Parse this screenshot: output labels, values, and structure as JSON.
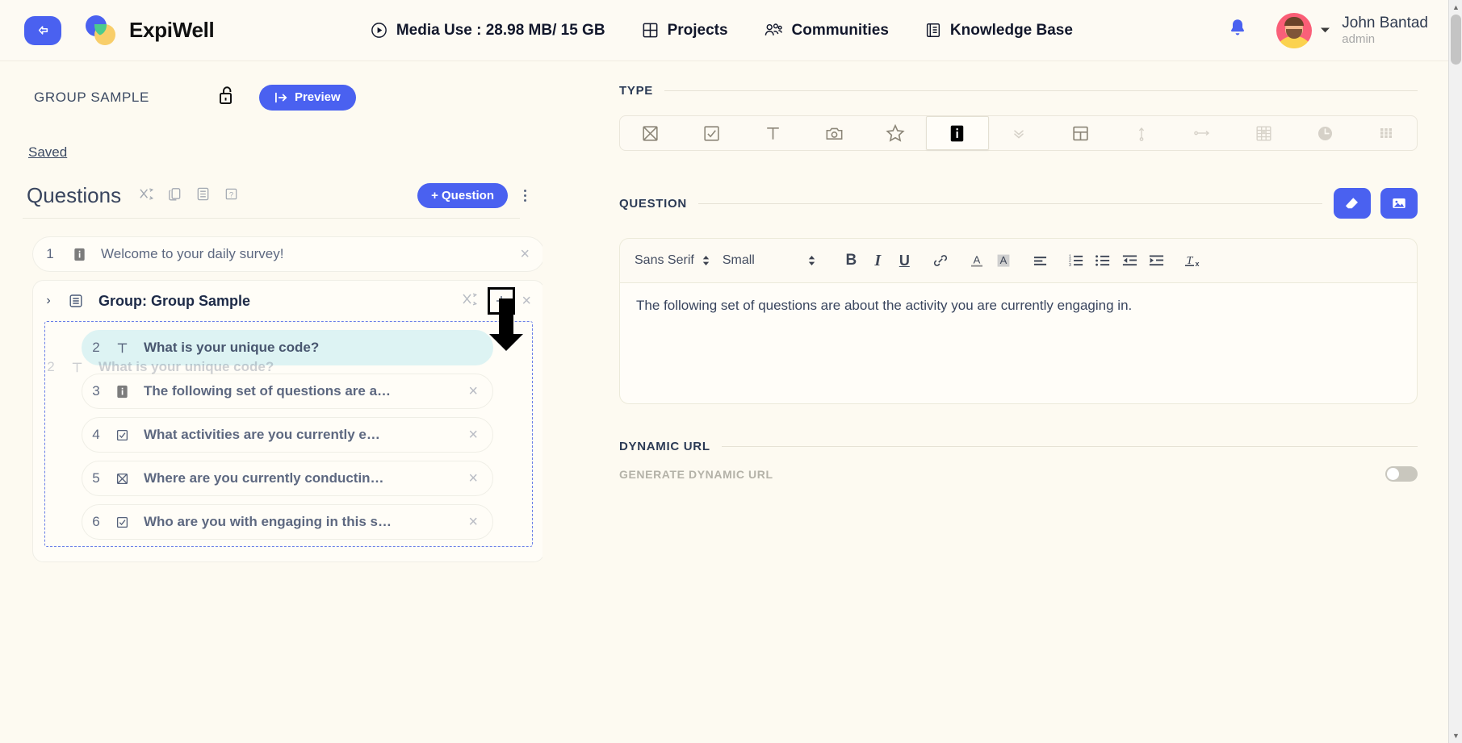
{
  "topbar": {
    "back_icon": "back-arrow-icon",
    "brand": "ExpiWell",
    "media_use": "Media Use : 28.98 MB/ 15 GB",
    "nav": [
      {
        "label": "Projects",
        "icon": "grid-icon"
      },
      {
        "label": "Communities",
        "icon": "people-icon"
      },
      {
        "label": "Knowledge Base",
        "icon": "book-icon"
      }
    ],
    "bell_icon": "notification-bell-icon",
    "user": {
      "name": "John Bantad",
      "role": "admin",
      "avatar": "user-avatar"
    }
  },
  "left": {
    "survey_title": "GROUP SAMPLE",
    "lock_icon": "unlocked-padlock-icon",
    "preview_label": "Preview",
    "preview_icon": "preview-arrow-icon",
    "saved_label": "Saved",
    "questions_title": "Questions",
    "tools": [
      {
        "icon": "shuffle-icon",
        "name": "shuffle-questions"
      },
      {
        "icon": "copy-icon",
        "name": "duplicate-questions"
      },
      {
        "icon": "list-icon",
        "name": "question-list"
      },
      {
        "icon": "help-icon",
        "name": "help"
      }
    ],
    "add_question_label": "+ Question",
    "kebab_icon": "more-options-icon",
    "items": [
      {
        "num": "1",
        "type_icon": "info-icon",
        "text": "Welcome to your daily survey!",
        "bold": false,
        "closable": true
      }
    ],
    "group": {
      "chevron": "chevron-right-icon",
      "icon": "group-list-icon",
      "label": "Group: Group Sample",
      "shuffle_icon": "shuffle-icon",
      "add_icon": "plus-icon",
      "close_icon": "close-icon",
      "children": [
        {
          "num": "2",
          "type_icon": "text-input-icon",
          "text": "What is your unique code?",
          "active": true,
          "closable": false
        },
        {
          "num": "3",
          "type_icon": "info-icon",
          "text": "The following set of questions are a…",
          "active": false,
          "closable": true
        },
        {
          "num": "4",
          "type_icon": "checkbox-icon",
          "text": "What activities are you currently e…",
          "active": false,
          "closable": true
        },
        {
          "num": "5",
          "type_icon": "radio-x-icon",
          "text": "Where are you currently conductin…",
          "active": false,
          "closable": true
        },
        {
          "num": "6",
          "type_icon": "checkbox-icon",
          "text": "Who are you with engaging in this s…",
          "active": false,
          "closable": true
        }
      ]
    },
    "drag_ghost": {
      "num": "2",
      "type_icon": "text-input-icon",
      "text": "What is your unique code?"
    },
    "annotation": {
      "arrow_icon": "down-arrow-annotation",
      "highlight_box": "plus-button-highlight"
    }
  },
  "right": {
    "type_section_label": "TYPE",
    "type_options": [
      {
        "icon": "single-choice-x-icon",
        "name": "type-single-choice",
        "selected": false,
        "dim": false
      },
      {
        "icon": "multi-choice-check-icon",
        "name": "type-multiple-choice",
        "selected": false,
        "dim": false
      },
      {
        "icon": "text-T-icon",
        "name": "type-text",
        "selected": false,
        "dim": false
      },
      {
        "icon": "camera-icon",
        "name": "type-media",
        "selected": false,
        "dim": false
      },
      {
        "icon": "star-icon",
        "name": "type-rating",
        "selected": false,
        "dim": false
      },
      {
        "icon": "info-icon",
        "name": "type-information",
        "selected": true,
        "dim": false
      },
      {
        "icon": "chevron-double-down-icon",
        "name": "type-dropdown",
        "selected": false,
        "dim": true
      },
      {
        "icon": "layout-grid-icon",
        "name": "type-layout",
        "selected": false,
        "dim": false
      },
      {
        "icon": "vertical-slider-icon",
        "name": "type-vertical-slider",
        "selected": false,
        "dim": true
      },
      {
        "icon": "horizontal-slider-icon",
        "name": "type-horizontal-slider",
        "selected": false,
        "dim": true
      },
      {
        "icon": "table-icon",
        "name": "type-table",
        "selected": false,
        "dim": true
      },
      {
        "icon": "clock-icon",
        "name": "type-time",
        "selected": false,
        "dim": true
      },
      {
        "icon": "keypad-icon",
        "name": "type-keypad",
        "selected": false,
        "dim": true
      }
    ],
    "question_section_label": "QUESTION",
    "question_actions": [
      {
        "icon": "eraser-icon",
        "name": "clear-formatting-button"
      },
      {
        "icon": "image-icon",
        "name": "insert-image-button"
      }
    ],
    "editor": {
      "font_family": "Sans Serif",
      "font_size": "Small",
      "tools": [
        {
          "icon": "bold-icon",
          "name": "bold-button"
        },
        {
          "icon": "italic-icon",
          "name": "italic-button"
        },
        {
          "icon": "underline-icon",
          "name": "underline-button"
        },
        {
          "icon": "link-icon",
          "name": "insert-link-button"
        },
        {
          "icon": "text-color-icon",
          "name": "text-color-button"
        },
        {
          "icon": "highlight-color-icon",
          "name": "highlight-color-button"
        },
        {
          "icon": "align-left-icon",
          "name": "align-button"
        },
        {
          "icon": "ordered-list-icon",
          "name": "ordered-list-button"
        },
        {
          "icon": "bullet-list-icon",
          "name": "bullet-list-button"
        },
        {
          "icon": "outdent-icon",
          "name": "outdent-button"
        },
        {
          "icon": "indent-icon",
          "name": "indent-button"
        },
        {
          "icon": "clear-format-icon",
          "name": "remove-format-button"
        }
      ],
      "content": "The following set of questions are about the activity you are currently engaging in."
    },
    "dynamic_url_label": "DYNAMIC URL",
    "generate_dynamic_url_label": "GENERATE DYNAMIC URL",
    "generate_dynamic_url_on": false
  },
  "scrollbar": {
    "up_icon": "scroll-up-arrow",
    "down_icon": "scroll-down-arrow"
  },
  "colors": {
    "accent": "#4a61f0",
    "bg": "#fdfaf1",
    "active_row": "#ddf3f3",
    "text": "#2b3a55"
  }
}
